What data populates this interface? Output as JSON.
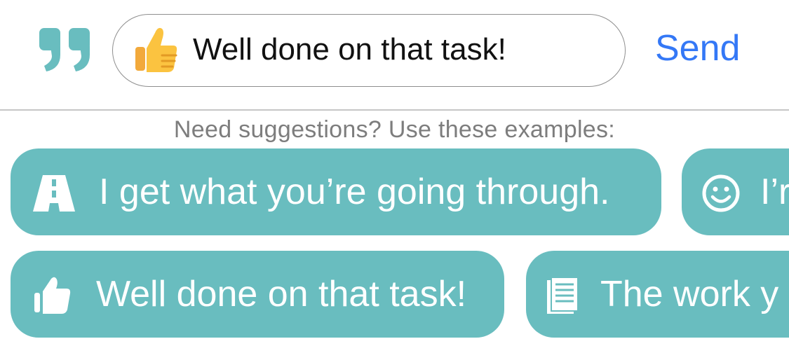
{
  "compose": {
    "quote_icon": "quote-mark-icon",
    "emoji": "thumbs-up-emoji",
    "input_value": "Well done on that task!",
    "send_label": "Send",
    "accent_color": "#69bdbf",
    "send_color": "#3478f6"
  },
  "suggestions": {
    "hint": "Need suggestions? Use these examples:",
    "items": [
      {
        "icon": "road-icon",
        "label": "I get what you’re going through."
      },
      {
        "icon": "smiley-icon",
        "label": "I’r"
      },
      {
        "icon": "thumbs-up-icon",
        "label": "Well done on that task!"
      },
      {
        "icon": "document-icon",
        "label": "The work y"
      }
    ]
  }
}
